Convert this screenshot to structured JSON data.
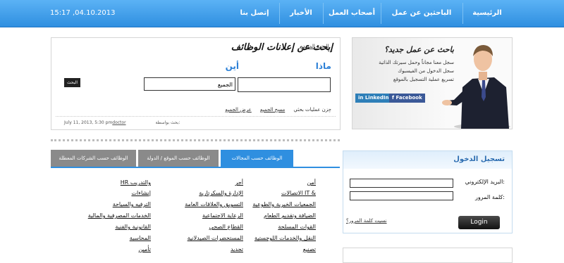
{
  "header": {
    "datetime": "15:17 ,04.10.2013",
    "nav": [
      "الرئيسية",
      "الباحثين عن عمل",
      "أصحاب العمل",
      "الأخبار",
      "إتصل بنا"
    ]
  },
  "search": {
    "title": "إبحث عن إعلانات الوظائف",
    "advanced": "البحث المتقدم",
    "what_label": "ماذا",
    "where_label": "أين",
    "what_value": "",
    "where_value": "الجميع",
    "button": "البحث",
    "show_all": "عرض الجميع",
    "clear_all": "مسح الجميع",
    "save_searches": "حِزن عمليات بحثي",
    "posted_by": "بحث بواسطة:",
    "posted_date": "July 11, 2013, 5:30 pm",
    "posted_user": "doctor"
  },
  "banner": {
    "title": "باحث عن عمل جديد؟",
    "lines": [
      "سجل معنا مجاناً وحمل سيرتك الذاتية",
      "سجل الدخول من الفيسبوك",
      "تسريع عملية التسجيل بالموقع"
    ],
    "linkedin": "LinkedIn",
    "facebook": "Facebook",
    "colors": {
      "linkedin": "#2e7fb8",
      "facebook": "#3b5998"
    }
  },
  "tabs": [
    "الوظائف حسب المجالات",
    "الوظائف حسب الموقع / الدولة",
    "الوظائف حسب الشركات المعطلة"
  ],
  "categories": {
    "col1": [
      "أمن",
      "الاتصالات IT &",
      "الجمعيات الخيرية والطوعية",
      "الضيافة وتقديم الطعام",
      "القوات المسلحة",
      "النقل والخدمات اللوجستية",
      "تصنيع"
    ],
    "col2": [
      "أجر",
      "الإدارة والسكرتارية",
      "التسويق والعلاقات العامة",
      "الرعاية الاجتماعية",
      "القطاع الصحي",
      "المستحضرات الصيدلانية",
      "تجديد"
    ],
    "col3": [
      "HR والتدريب",
      "إنشاءات",
      "الترفيه والسياحة",
      "الخدمات المصرفية والمالية",
      "القانونية والفنية",
      "المحاسبة",
      "تأمين"
    ]
  },
  "login": {
    "title": "تسجيل الدخول",
    "email_label": "البريد الإلكتروني:",
    "password_label": "كلمة المرور:",
    "forgot": "نسيت كلمة المرور؟",
    "button": "Login"
  },
  "colors": {
    "accent": "#2f8fe0",
    "tab_active": "#2f8fe0",
    "tab_inactive": "#8a8a8a"
  }
}
